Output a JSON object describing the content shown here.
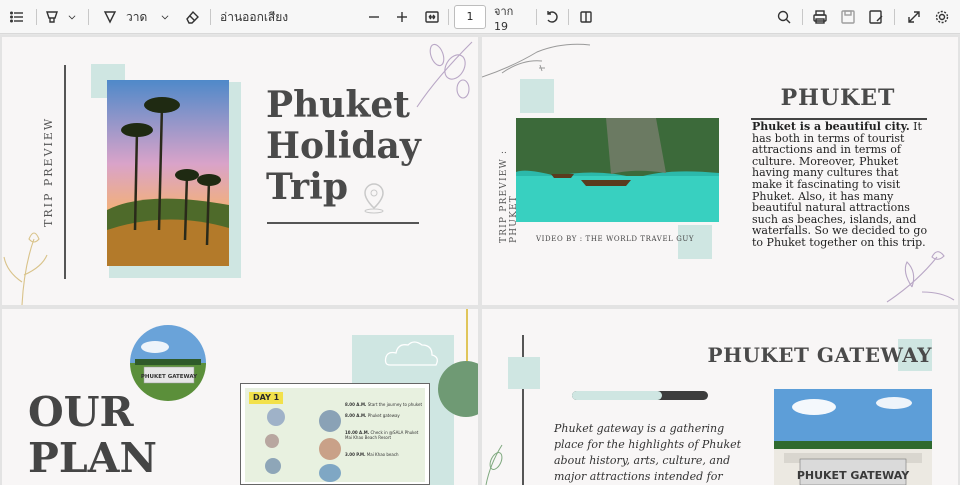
{
  "toolbar": {
    "draw_label": "วาด",
    "read_aloud_label": "อ่านออกเสียง",
    "page_current": "1",
    "page_total": "จาก 19",
    "icons": [
      "contents-icon",
      "highlight-icon",
      "draw-icon",
      "eraser-icon",
      "zoom-out-icon",
      "zoom-in-icon",
      "fit-width-icon",
      "rotate-icon",
      "page-view-icon",
      "search-icon",
      "print-icon",
      "save-icon",
      "save-as-icon",
      "fullscreen-icon",
      "settings-icon"
    ]
  },
  "slide1": {
    "vertical_text": "TRIP PREVIEW",
    "title_line1": "Phuket",
    "title_line2": "Holiday",
    "title_line3": "Trip"
  },
  "slide2": {
    "vertical_text": "TRIP PREVIEW : PHUKET",
    "heading": "PHUKET",
    "bold_lead": "Phuket is a beautiful city.",
    "body": " It has both in terms of tourist attractions and in terms of culture. Moreover, Phuket having many cultures that make it fascinating to visit Phuket. Also, it has many beautiful natural attractions such as beaches, islands, and waterfalls. So we decided to go to Phuket together on this trip.",
    "video_by": "VIDEO BY :   THE WORLD TRAVEL GUY"
  },
  "slide3": {
    "title_line1": "OUR",
    "title_line2": "PLAN",
    "sign_text": "PHUKET GATEWAY",
    "day_label": "DAY 1",
    "schedule": [
      {
        "time": "8.00 A.M.",
        "text": "Start the journey to phuket"
      },
      {
        "time": "8.00 A.M.",
        "text": "Phuket gateway"
      },
      {
        "time": "10.00 A.M.",
        "text": "Check in @SALA Phuket Mai Khao Beach Resort"
      },
      {
        "time": "3.00 P.M.",
        "text": "Mai Khao beach"
      }
    ]
  },
  "slide4": {
    "heading": "PHUKET GATEWAY",
    "body": "Phuket gateway is a gathering place for the highlights of Phuket about history, arts, culture, and major attractions intended for tourists to",
    "sign_text": "PHUKET GATEWAY"
  }
}
